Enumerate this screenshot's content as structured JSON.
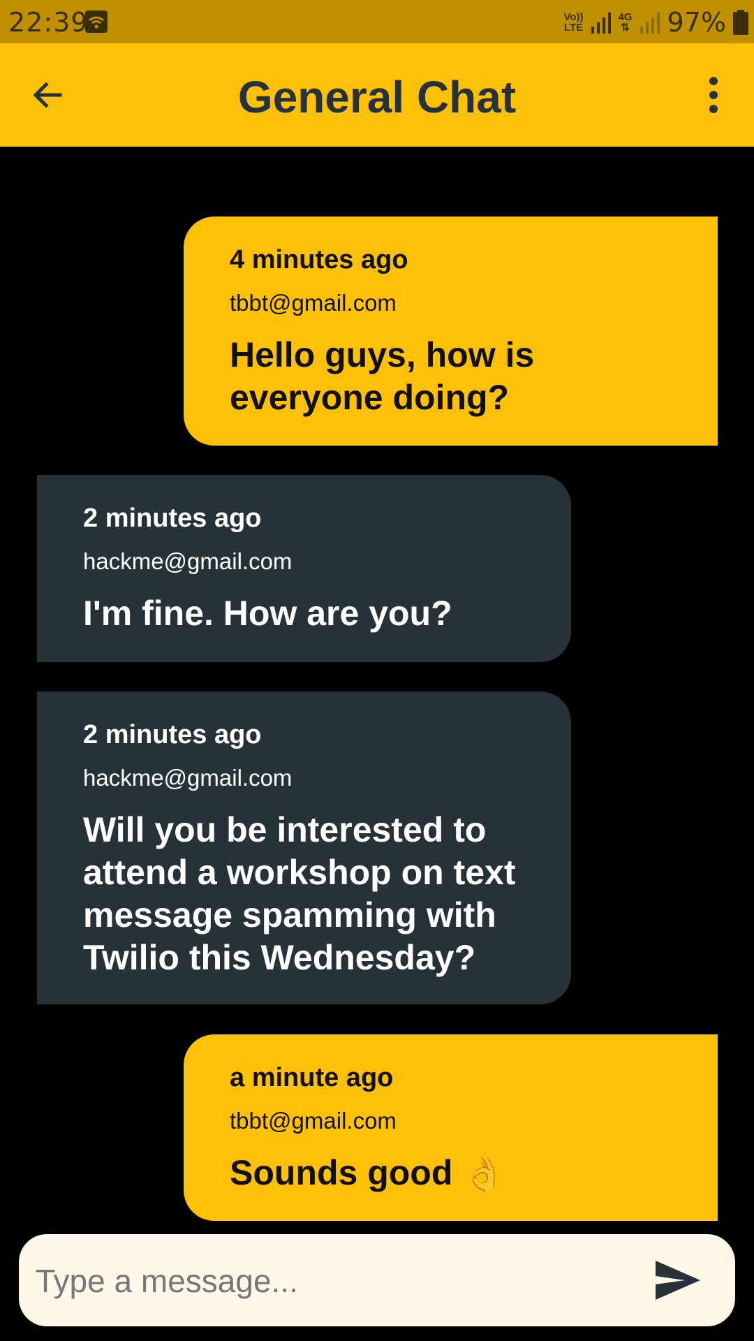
{
  "status_bar": {
    "time": "22:39",
    "network_top": "Vo))",
    "network_bottom": "LTE",
    "network_type": "4G",
    "battery": "97%",
    "icons": [
      "wifi-icon",
      "signal-icon",
      "signal-icon",
      "battery-icon"
    ]
  },
  "app_bar": {
    "title": "General Chat",
    "back_icon": "arrow-back-icon",
    "menu_icon": "more-vert-icon"
  },
  "messages": [
    {
      "side": "sent",
      "time": "4 minutes ago",
      "sender": "tbbt@gmail.com",
      "text": "Hello guys, how is everyone doing?"
    },
    {
      "side": "received",
      "time": "2 minutes ago",
      "sender": "hackme@gmail.com",
      "text": "I'm fine. How are you?"
    },
    {
      "side": "received",
      "time": "2 minutes ago",
      "sender": "hackme@gmail.com",
      "text": "Will you be interested to attend a workshop on text message spamming with Twilio this Wednesday?"
    },
    {
      "side": "sent",
      "time": "a minute ago",
      "sender": "tbbt@gmail.com",
      "text": "Sounds good 👌"
    }
  ],
  "composer": {
    "placeholder": "Type a message...",
    "value": "",
    "send_icon": "send-icon"
  },
  "colors": {
    "primary": "#FFC107",
    "status_bar": "#BF9000",
    "received_bubble": "#263238",
    "background": "#000000",
    "composer_bg": "#FFF8E8"
  }
}
